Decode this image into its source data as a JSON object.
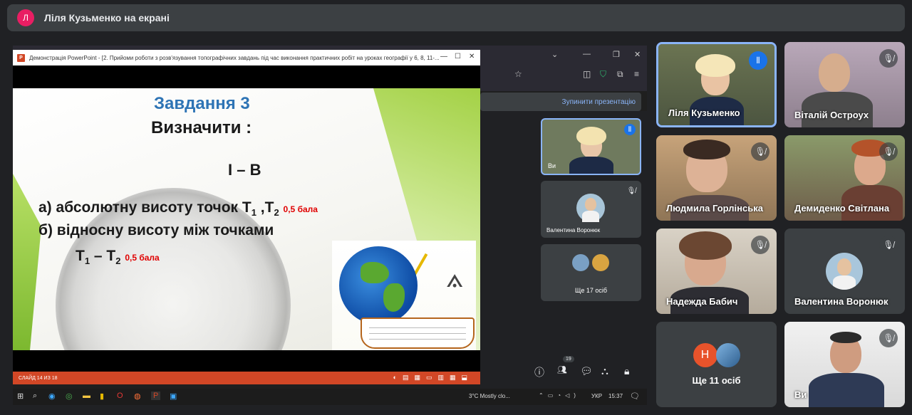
{
  "banner": {
    "avatar_letter": "Л",
    "title": "Ліля Кузьменко на екрані"
  },
  "ppt": {
    "window_title": "Демонстрація PowerPoint - [2. Прийоми роботи з розв'язування топографічних завдань  під час виконання практичних робіт  на уроках географії у 6, 8, 11-...",
    "icon_letter": "P",
    "status": "СЛАЙД 14 ИЗ 18",
    "slide": {
      "heading": "Завдання 3",
      "sub": "Визначити :",
      "variant": "I – B",
      "line_a": "а)  абсолютну висоту точок Т",
      "line_a_s1": "1",
      "line_a_mid": " ,Т",
      "line_a_s2": "2",
      "score_a": "0,5 бала",
      "line_b": "б)  відносну висоту між точками",
      "line_c": "Т",
      "line_c_s1": "1",
      "line_c_mid": " – Т",
      "line_c_s2": "2",
      "score_c": "0,5 бала"
    }
  },
  "inner_meet": {
    "stop_label": "Зупинити презентацію",
    "self_label": "Ви",
    "tile2_name": "Валентина Воронюк",
    "more_label": "Ще 17 осіб",
    "badge_count": "19"
  },
  "taskbar": {
    "weather": "3°C  Mostly clo...",
    "lang": "УКР",
    "time": "15:37"
  },
  "tiles": [
    {
      "name": "Ліля Кузьменко",
      "accent": "#1a73e8"
    },
    {
      "name": "Віталій Остроух"
    },
    {
      "name": "Людмила Горлінська"
    },
    {
      "name": "Демиденко Світлана"
    },
    {
      "name": "Надежда Бабич"
    },
    {
      "name": "Валентина Воронюк"
    },
    {
      "name": "Ще 11 осіб",
      "avatar_letter": "Н"
    },
    {
      "name": "Ви"
    }
  ]
}
